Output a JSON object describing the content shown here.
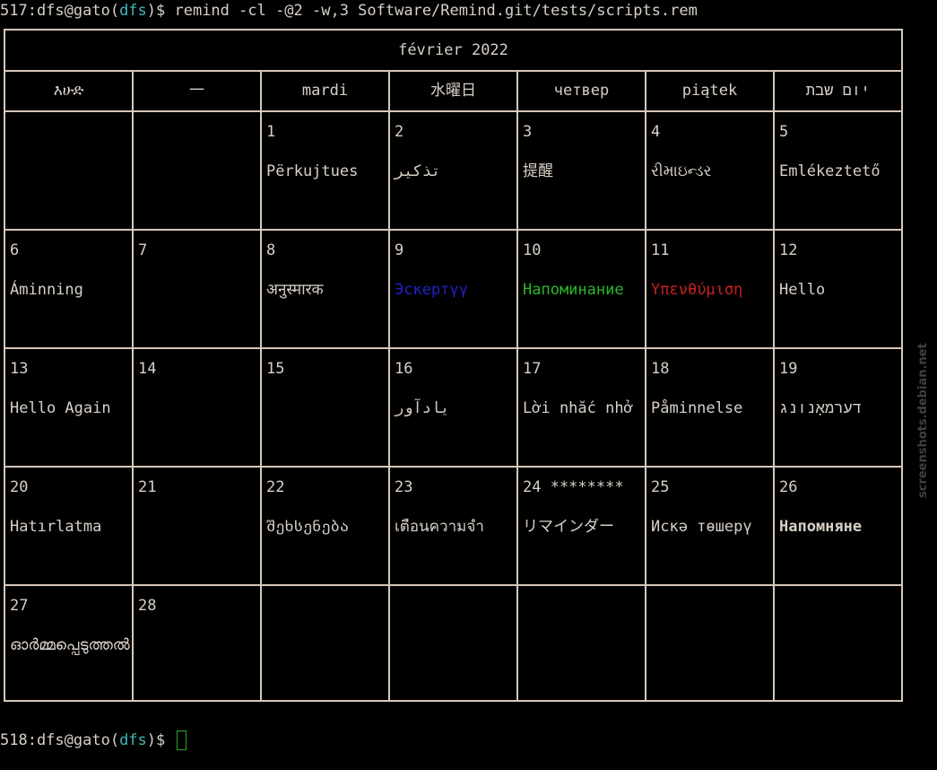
{
  "terminal": {
    "cmd_prefix": "517:dfs@gato(",
    "cmd_dir": "dfs",
    "cmd_suffix": ")$ remind -cl -@2 -w,3 Software/Remind.git/tests/scripts.rem",
    "prompt_prefix": "518:dfs@gato(",
    "prompt_dir": "dfs",
    "prompt_suffix": ")$ "
  },
  "calendar": {
    "title": "février 2022",
    "weekdays": [
      "እሁድ",
      "一",
      "mardi",
      "水曜日",
      "четвер",
      "piątek",
      "יום שבת"
    ],
    "weeks": [
      [
        {
          "day": "",
          "text": ""
        },
        {
          "day": "",
          "text": ""
        },
        {
          "day": "1",
          "text": "Përkujtues"
        },
        {
          "day": "2",
          "text": "تذكير"
        },
        {
          "day": "3",
          "text": "提醒"
        },
        {
          "day": "4",
          "text": "રીમાઇન્ડર"
        },
        {
          "day": "5",
          "text": "Emlékeztető"
        }
      ],
      [
        {
          "day": "6",
          "text": "Áminning"
        },
        {
          "day": "7",
          "text": ""
        },
        {
          "day": "8",
          "text": "अनुस्मारक"
        },
        {
          "day": "9",
          "text": "Эскертүү",
          "color": "blue"
        },
        {
          "day": "10",
          "text": "Напоминание",
          "color": "green"
        },
        {
          "day": "11",
          "text": "Υπενθύμιση",
          "color": "red"
        },
        {
          "day": "12",
          "text": "Hello"
        }
      ],
      [
        {
          "day": "13",
          "text": "Hello Again"
        },
        {
          "day": "14",
          "text": ""
        },
        {
          "day": "15",
          "text": ""
        },
        {
          "day": "16",
          "text": "یادآور"
        },
        {
          "day": "17",
          "text": "Lời nhắc nhở"
        },
        {
          "day": "18",
          "text": "Påminnelse"
        },
        {
          "day": "19",
          "text": "דערמאָנונג"
        }
      ],
      [
        {
          "day": "20",
          "text": "Hatırlatma"
        },
        {
          "day": "21",
          "text": ""
        },
        {
          "day": "22",
          "text": "შეხსენება"
        },
        {
          "day": "23",
          "text": "เตือนความจำ"
        },
        {
          "day": "24 ********",
          "text": "リマインダー"
        },
        {
          "day": "25",
          "text": "Искә төшерү"
        },
        {
          "day": "26",
          "text": "Напомняне",
          "bold": true
        }
      ],
      [
        {
          "day": "27",
          "text": "ഓർമ്മപ്പെടുത്തൽ"
        },
        {
          "day": "28",
          "text": ""
        },
        {
          "day": "",
          "text": ""
        },
        {
          "day": "",
          "text": ""
        },
        {
          "day": "",
          "text": ""
        },
        {
          "day": "",
          "text": ""
        },
        {
          "day": "",
          "text": ""
        }
      ]
    ]
  },
  "watermark": "screenshots.debian.net",
  "colors": {
    "background": "#000000",
    "foreground": "#d8d0c8",
    "border": "#d8c8b8",
    "cyan": "#3fb8b8",
    "blue": "#2020c8",
    "green": "#2ab82a",
    "red": "#c82020",
    "cursor": "#2aa52a"
  }
}
